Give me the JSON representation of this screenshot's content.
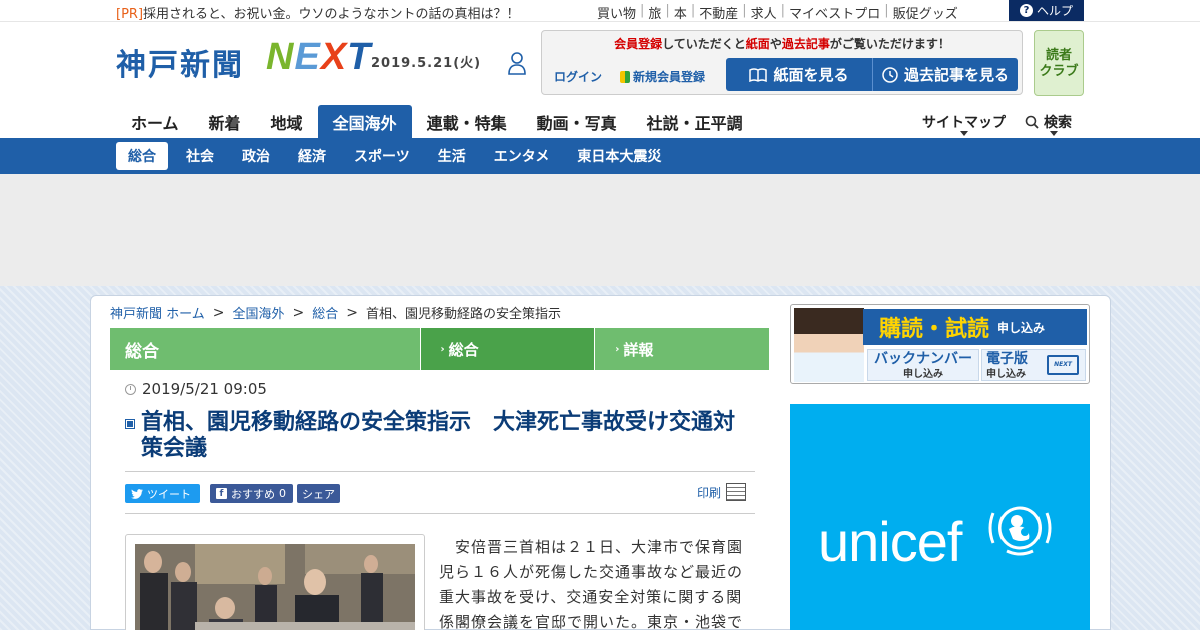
{
  "topbar": {
    "pr_tag": "[PR]",
    "pr_text": "採用されると、お祝い金。ウソのようなホントの話の真相は？！",
    "links": [
      "買い物",
      "旅",
      "本",
      "不動産",
      "求人",
      "マイベストプロ",
      "販促グッズ"
    ],
    "help_label": "ヘルプ"
  },
  "header": {
    "logo": "神戸新聞",
    "logo_next": [
      "N",
      "E",
      "X",
      "T"
    ],
    "date": "2019.5.21(火)",
    "member_msg": [
      "会員登録",
      "していただくと",
      "紙面",
      "や",
      "過去記事",
      "がご覧いただけます！"
    ],
    "login": "ログイン",
    "new_member": "新規会員登録",
    "paper_button": "紙面を見る",
    "past_button": "過去記事を見る",
    "club": [
      "読者",
      "クラブ"
    ]
  },
  "nav": {
    "main": [
      "ホーム",
      "新着",
      "地域",
      "全国海外",
      "連載・特集",
      "動画・写真",
      "社説・正平調"
    ],
    "active_index": 3,
    "sitemap": "サイトマップ",
    "search": "検索",
    "sub": [
      "総合",
      "社会",
      "政治",
      "経済",
      "スポーツ",
      "生活",
      "エンタメ",
      "東日本大震災"
    ]
  },
  "breadcrumb": [
    "神戸新聞 ホーム",
    "全国海外",
    "総合",
    "首相、園児移動経路の安全策指示"
  ],
  "section": {
    "title": "総合",
    "tabs": [
      "総合",
      "詳報"
    ]
  },
  "article": {
    "date": "2019/5/21 09:05",
    "headline": "首相、園児移動経路の安全策指示　大津死亡事故受け交通対策会議",
    "tweet": "ツイート",
    "recommend": "おすすめ",
    "recommend_count": "0",
    "share": "シェア",
    "print": "印刷",
    "body": "　安倍晋三首相は２１日、大津市で保育園児ら１６人が死傷した交通事故など最近の重大事故を受け、交通安全対策に関する関係閣僚会議を官邸で開いた。東京・池袋で"
  },
  "sidebar": {
    "subscribe_title": "購読・試読",
    "subscribe_small": "申し込み",
    "backnumber": "バックナンバー",
    "backnumber_small": "申し込み",
    "edition": "電子版",
    "edition_small": "申し込み",
    "laptop_text": "NEXT",
    "unicef": "unicef"
  },
  "colors": {
    "brand_blue": "#1f5fa8",
    "green_bar": "#6fbd6f",
    "unicef_blue": "#00aeef"
  }
}
